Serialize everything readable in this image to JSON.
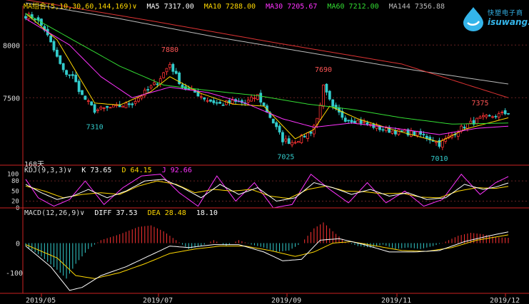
{
  "chart_data": [
    {
      "type": "candlestick",
      "instrument_note": "168天",
      "legend": {
        "label": "MA组合(5,10,30,60,144,169)",
        "items": [
          {
            "name": "MA5",
            "value": "7317.00",
            "color": "#ffffff"
          },
          {
            "name": "MA10",
            "value": "7288.00",
            "color": "#ffd800"
          },
          {
            "name": "MA30",
            "value": "7205.67",
            "color": "#ff33ff"
          },
          {
            "name": "MA60",
            "value": "7212.00",
            "color": "#33dd33"
          },
          {
            "name": "MA144",
            "value": "7356.88",
            "color": "#bbbbbb"
          }
        ]
      },
      "ylim": [
        6860,
        8360
      ],
      "y_ticks": [
        8000,
        7500
      ],
      "grid_dashed": [
        8000,
        7500
      ],
      "annotations": [
        {
          "text": "7310",
          "index": 22,
          "value": 7310,
          "color": "#33cccc"
        },
        {
          "text": "7880",
          "index": 46,
          "value": 7880,
          "color": "#ff5555"
        },
        {
          "text": "7690",
          "index": 95,
          "value": 7690,
          "color": "#ff5555"
        },
        {
          "text": "7025",
          "index": 83,
          "value": 7025,
          "color": "#33cccc"
        },
        {
          "text": "7010",
          "index": 132,
          "value": 7010,
          "color": "#33cccc"
        },
        {
          "text": "7375",
          "index": 145,
          "value": 7375,
          "color": "#ff5555"
        }
      ],
      "close_anchors": [
        [
          0,
          8280
        ],
        [
          3,
          8260
        ],
        [
          6,
          8150
        ],
        [
          9,
          7950
        ],
        [
          12,
          7750
        ],
        [
          15,
          7700
        ],
        [
          18,
          7520
        ],
        [
          22,
          7380
        ],
        [
          26,
          7400
        ],
        [
          30,
          7420
        ],
        [
          34,
          7450
        ],
        [
          38,
          7550
        ],
        [
          42,
          7650
        ],
        [
          46,
          7820
        ],
        [
          50,
          7600
        ],
        [
          54,
          7550
        ],
        [
          58,
          7480
        ],
        [
          62,
          7440
        ],
        [
          66,
          7460
        ],
        [
          70,
          7450
        ],
        [
          74,
          7520
        ],
        [
          78,
          7320
        ],
        [
          82,
          7100
        ],
        [
          85,
          7080
        ],
        [
          88,
          7120
        ],
        [
          91,
          7180
        ],
        [
          93,
          7300
        ],
        [
          95,
          7600
        ],
        [
          98,
          7400
        ],
        [
          102,
          7300
        ],
        [
          106,
          7280
        ],
        [
          110,
          7240
        ],
        [
          114,
          7200
        ],
        [
          118,
          7180
        ],
        [
          122,
          7170
        ],
        [
          126,
          7150
        ],
        [
          130,
          7100
        ],
        [
          132,
          7060
        ],
        [
          136,
          7150
        ],
        [
          140,
          7230
        ],
        [
          145,
          7300
        ],
        [
          150,
          7330
        ],
        [
          154,
          7360
        ]
      ],
      "ma_anchors": {
        "ma10": [
          [
            0,
            8300
          ],
          [
            10,
            8050
          ],
          [
            22,
            7450
          ],
          [
            30,
            7430
          ],
          [
            40,
            7560
          ],
          [
            46,
            7700
          ],
          [
            56,
            7540
          ],
          [
            66,
            7440
          ],
          [
            76,
            7420
          ],
          [
            86,
            7110
          ],
          [
            92,
            7200
          ],
          [
            97,
            7420
          ],
          [
            106,
            7300
          ],
          [
            118,
            7190
          ],
          [
            132,
            7080
          ],
          [
            140,
            7200
          ],
          [
            154,
            7310
          ]
        ],
        "ma30": [
          [
            0,
            8250
          ],
          [
            14,
            8000
          ],
          [
            24,
            7700
          ],
          [
            34,
            7500
          ],
          [
            46,
            7600
          ],
          [
            58,
            7550
          ],
          [
            70,
            7450
          ],
          [
            82,
            7300
          ],
          [
            92,
            7220
          ],
          [
            104,
            7260
          ],
          [
            118,
            7210
          ],
          [
            132,
            7150
          ],
          [
            144,
            7210
          ],
          [
            154,
            7230
          ]
        ],
        "ma60": [
          [
            0,
            8300
          ],
          [
            18,
            8000
          ],
          [
            30,
            7800
          ],
          [
            44,
            7620
          ],
          [
            58,
            7570
          ],
          [
            74,
            7520
          ],
          [
            90,
            7440
          ],
          [
            104,
            7390
          ],
          [
            120,
            7310
          ],
          [
            136,
            7250
          ],
          [
            154,
            7260
          ]
        ],
        "ma144": [
          [
            0,
            8400
          ],
          [
            30,
            8250
          ],
          [
            60,
            8080
          ],
          [
            90,
            7930
          ],
          [
            120,
            7780
          ],
          [
            154,
            7630
          ]
        ],
        "ma169": [
          [
            0,
            8430
          ],
          [
            40,
            8230
          ],
          [
            80,
            8020
          ],
          [
            120,
            7820
          ],
          [
            154,
            7500
          ]
        ]
      },
      "ma_colors": {
        "ma10": "#ffd800",
        "ma30": "#ff33ff",
        "ma60": "#33dd33",
        "ma144": "#bbbbbb",
        "ma169": "#dd3333"
      }
    },
    {
      "type": "line",
      "legend": {
        "label": "KDJ(9,3,3)",
        "items": [
          {
            "name": "K",
            "value": "73.65",
            "color": "#ffffff"
          },
          {
            "name": "D",
            "value": "64.15",
            "color": "#ffd800"
          },
          {
            "name": "J",
            "value": "92.66",
            "color": "#ff33ff"
          }
        ]
      },
      "ylim": [
        0,
        110
      ],
      "y_ticks": [
        100,
        80,
        50,
        20,
        0
      ],
      "k_anchors": [
        [
          0,
          70
        ],
        [
          5,
          45
        ],
        [
          10,
          25
        ],
        [
          15,
          35
        ],
        [
          20,
          55
        ],
        [
          26,
          30
        ],
        [
          32,
          50
        ],
        [
          38,
          80
        ],
        [
          44,
          85
        ],
        [
          50,
          60
        ],
        [
          56,
          30
        ],
        [
          62,
          70
        ],
        [
          68,
          40
        ],
        [
          74,
          60
        ],
        [
          80,
          20
        ],
        [
          86,
          30
        ],
        [
          92,
          75
        ],
        [
          98,
          60
        ],
        [
          104,
          40
        ],
        [
          110,
          55
        ],
        [
          116,
          35
        ],
        [
          122,
          45
        ],
        [
          128,
          25
        ],
        [
          134,
          30
        ],
        [
          140,
          70
        ],
        [
          146,
          55
        ],
        [
          150,
          62
        ],
        [
          154,
          74
        ]
      ],
      "d_anchors": [
        [
          0,
          65
        ],
        [
          6,
          50
        ],
        [
          12,
          30
        ],
        [
          18,
          40
        ],
        [
          24,
          45
        ],
        [
          30,
          40
        ],
        [
          36,
          65
        ],
        [
          42,
          80
        ],
        [
          48,
          70
        ],
        [
          54,
          45
        ],
        [
          60,
          55
        ],
        [
          66,
          50
        ],
        [
          72,
          55
        ],
        [
          78,
          35
        ],
        [
          84,
          28
        ],
        [
          90,
          55
        ],
        [
          96,
          65
        ],
        [
          102,
          50
        ],
        [
          108,
          48
        ],
        [
          114,
          42
        ],
        [
          120,
          44
        ],
        [
          126,
          32
        ],
        [
          132,
          30
        ],
        [
          138,
          50
        ],
        [
          144,
          60
        ],
        [
          150,
          58
        ],
        [
          154,
          64
        ]
      ],
      "j_anchors": [
        [
          0,
          85
        ],
        [
          4,
          30
        ],
        [
          9,
          5
        ],
        [
          14,
          25
        ],
        [
          19,
          80
        ],
        [
          25,
          10
        ],
        [
          31,
          60
        ],
        [
          37,
          95
        ],
        [
          43,
          100
        ],
        [
          49,
          45
        ],
        [
          55,
          5
        ],
        [
          61,
          95
        ],
        [
          67,
          20
        ],
        [
          73,
          75
        ],
        [
          79,
          0
        ],
        [
          85,
          10
        ],
        [
          91,
          100
        ],
        [
          97,
          55
        ],
        [
          103,
          15
        ],
        [
          109,
          75
        ],
        [
          115,
          15
        ],
        [
          121,
          50
        ],
        [
          127,
          5
        ],
        [
          133,
          25
        ],
        [
          139,
          100
        ],
        [
          145,
          40
        ],
        [
          150,
          75
        ],
        [
          154,
          93
        ]
      ]
    },
    {
      "type": "bar",
      "legend": {
        "label": "MACD(12,26,9)",
        "items": [
          {
            "name": "DIFF",
            "value": "37.53",
            "color": "#ffffff"
          },
          {
            "name": "DEA",
            "value": "28.48",
            "color": "#ffd800"
          },
          {
            "name": "",
            "value": "18.10",
            "color": "#ffffff"
          }
        ]
      },
      "ylim": [
        -170,
        100
      ],
      "y_ticks": [
        0,
        -100
      ],
      "hist_anchors": [
        [
          0,
          -10
        ],
        [
          5,
          -45
        ],
        [
          10,
          -90
        ],
        [
          13,
          -120
        ],
        [
          16,
          -70
        ],
        [
          20,
          -20
        ],
        [
          24,
          10
        ],
        [
          30,
          30
        ],
        [
          36,
          55
        ],
        [
          40,
          60
        ],
        [
          44,
          40
        ],
        [
          48,
          10
        ],
        [
          52,
          -20
        ],
        [
          56,
          -10
        ],
        [
          60,
          10
        ],
        [
          64,
          -10
        ],
        [
          68,
          10
        ],
        [
          72,
          -5
        ],
        [
          76,
          -15
        ],
        [
          80,
          -30
        ],
        [
          84,
          -25
        ],
        [
          88,
          0
        ],
        [
          92,
          50
        ],
        [
          95,
          70
        ],
        [
          98,
          40
        ],
        [
          102,
          5
        ],
        [
          106,
          -10
        ],
        [
          110,
          -15
        ],
        [
          114,
          -5
        ],
        [
          118,
          -20
        ],
        [
          122,
          -15
        ],
        [
          126,
          -20
        ],
        [
          130,
          -10
        ],
        [
          134,
          5
        ],
        [
          138,
          25
        ],
        [
          142,
          35
        ],
        [
          146,
          30
        ],
        [
          150,
          20
        ],
        [
          154,
          18
        ]
      ],
      "diff_anchors": [
        [
          0,
          -10
        ],
        [
          8,
          -80
        ],
        [
          14,
          -160
        ],
        [
          18,
          -150
        ],
        [
          24,
          -110
        ],
        [
          32,
          -80
        ],
        [
          40,
          -40
        ],
        [
          46,
          -10
        ],
        [
          52,
          -15
        ],
        [
          60,
          -5
        ],
        [
          68,
          -5
        ],
        [
          76,
          -30
        ],
        [
          82,
          -60
        ],
        [
          88,
          -55
        ],
        [
          94,
          10
        ],
        [
          100,
          15
        ],
        [
          108,
          -5
        ],
        [
          116,
          -30
        ],
        [
          124,
          -30
        ],
        [
          132,
          -25
        ],
        [
          140,
          5
        ],
        [
          148,
          25
        ],
        [
          154,
          38
        ]
      ],
      "dea_anchors": [
        [
          0,
          -5
        ],
        [
          10,
          -50
        ],
        [
          16,
          -110
        ],
        [
          22,
          -120
        ],
        [
          30,
          -100
        ],
        [
          38,
          -70
        ],
        [
          46,
          -35
        ],
        [
          54,
          -20
        ],
        [
          62,
          -10
        ],
        [
          70,
          -10
        ],
        [
          78,
          -25
        ],
        [
          86,
          -45
        ],
        [
          92,
          -30
        ],
        [
          98,
          0
        ],
        [
          104,
          5
        ],
        [
          112,
          -10
        ],
        [
          120,
          -25
        ],
        [
          128,
          -28
        ],
        [
          136,
          -15
        ],
        [
          144,
          10
        ],
        [
          154,
          28
        ]
      ]
    }
  ],
  "x_axis": {
    "labels": [
      "2019/05",
      "2019/07",
      "2019/09",
      "2019/11",
      "2019/12"
    ]
  },
  "logo": {
    "cn_text": "快塑电子商",
    "en_text": "isuwang.co"
  },
  "colors": {
    "up": "#ff3333",
    "down": "#33cccc",
    "axis": "#cc2222",
    "grid": "#662222"
  }
}
